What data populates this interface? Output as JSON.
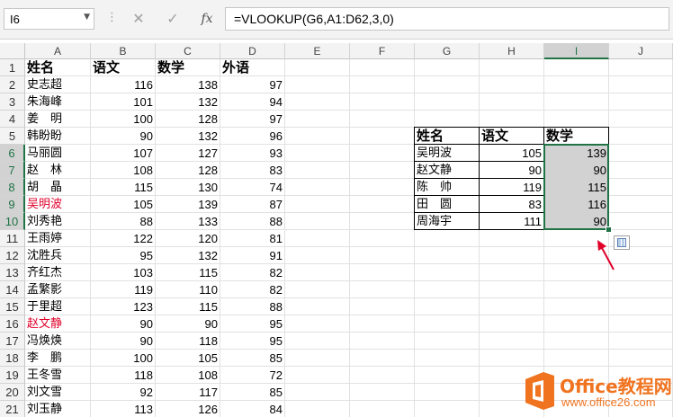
{
  "formula_bar": {
    "name_box": "I6",
    "cancel_icon": "✕",
    "enter_icon": "✓",
    "fx_label": "fx",
    "formula": "=VLOOKUP(G6,A1:D62,3,0)"
  },
  "columns": [
    "A",
    "B",
    "C",
    "D",
    "E",
    "F",
    "G",
    "H",
    "I",
    "J"
  ],
  "row_numbers": [
    "1",
    "2",
    "3",
    "4",
    "5",
    "6",
    "7",
    "8",
    "9",
    "10",
    "11",
    "12",
    "13",
    "14",
    "15",
    "16",
    "17",
    "18",
    "19",
    "20",
    "21"
  ],
  "main_table": {
    "headers": [
      "姓名",
      "语文",
      "数学",
      "外语"
    ],
    "rows": [
      [
        "史志超",
        "116",
        "138",
        "97"
      ],
      [
        "朱海峰",
        "101",
        "132",
        "94"
      ],
      [
        "姜　明",
        "100",
        "128",
        "97"
      ],
      [
        "韩盼盼",
        "90",
        "132",
        "96"
      ],
      [
        "马丽圆",
        "107",
        "127",
        "93"
      ],
      [
        "赵　林",
        "108",
        "128",
        "83"
      ],
      [
        "胡　晶",
        "115",
        "130",
        "74"
      ],
      [
        "吴明波",
        "105",
        "139",
        "87"
      ],
      [
        "刘秀艳",
        "88",
        "133",
        "88"
      ],
      [
        "王雨婷",
        "122",
        "120",
        "81"
      ],
      [
        "沈胜兵",
        "95",
        "132",
        "91"
      ],
      [
        "齐红杰",
        "103",
        "115",
        "82"
      ],
      [
        "孟繁影",
        "119",
        "110",
        "82"
      ],
      [
        "于里超",
        "123",
        "115",
        "88"
      ],
      [
        "赵文静",
        "90",
        "90",
        "95"
      ],
      [
        "冯焕焕",
        "90",
        "118",
        "95"
      ],
      [
        "李　鹏",
        "100",
        "105",
        "85"
      ],
      [
        "王冬雪",
        "118",
        "108",
        "72"
      ],
      [
        "刘文雪",
        "92",
        "117",
        "85"
      ],
      [
        "刘玉静",
        "113",
        "126",
        "84"
      ]
    ],
    "highlight_color": "#e0002a"
  },
  "lookup_table": {
    "headers": [
      "姓名",
      "语文",
      "数学"
    ],
    "rows": [
      [
        "吴明波",
        "105",
        "139"
      ],
      [
        "赵文静",
        "90",
        "90"
      ],
      [
        "陈　帅",
        "119",
        "115"
      ],
      [
        "田　圆",
        "83",
        "116"
      ],
      [
        "周海宇",
        "111",
        "90"
      ]
    ]
  },
  "selection": {
    "active_cell": "I6",
    "range": "I6:I10",
    "accent_color": "#217346"
  },
  "icons": {
    "name_box_dropdown": "chevron-down-icon",
    "quick_analysis": "quick-analysis-icon",
    "pointer_arrow": "red-arrow-icon"
  },
  "watermark": {
    "brand": "Office教程网",
    "url": "www.office26.com",
    "color": "#f0731f"
  }
}
